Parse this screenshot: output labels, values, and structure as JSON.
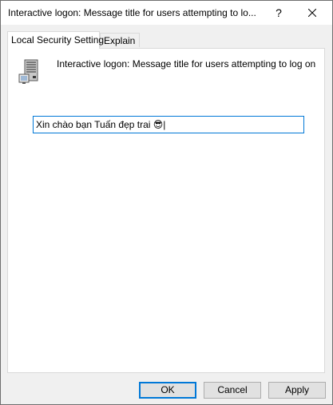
{
  "window": {
    "title": "Interactive logon: Message title for users attempting to lo...",
    "help_label": "?",
    "close_icon": "close-icon"
  },
  "tabs": [
    {
      "label": "Local Security Setting",
      "active": true
    },
    {
      "label": "Explain",
      "active": false
    }
  ],
  "policy": {
    "icon": "server-computer-icon",
    "name": "Interactive logon: Message title for users attempting to log on"
  },
  "setting": {
    "value": "Xin chào bạn Tuấn đẹp trai 😎|"
  },
  "buttons": {
    "ok": "OK",
    "cancel": "Cancel",
    "apply": "Apply"
  },
  "colors": {
    "accent": "#0078d7",
    "dialog_bg": "#f0f0f0",
    "panel_bg": "#ffffff"
  }
}
